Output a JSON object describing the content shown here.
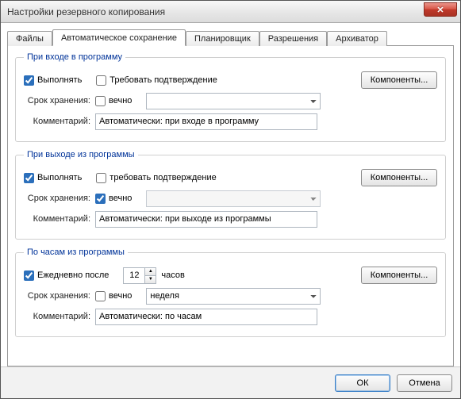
{
  "window": {
    "title": "Настройки резервного копирования"
  },
  "tabs": {
    "files": "Файлы",
    "autosave": "Автоматическое сохранение",
    "scheduler": "Планировщик",
    "permissions": "Разрешения",
    "archiver": "Архиватор"
  },
  "common": {
    "components_btn": "Компоненты...",
    "storage_label": "Срок хранения:",
    "forever": "вечно",
    "comment_label": "Комментарий:"
  },
  "login_group": {
    "legend": "При входе в программу",
    "execute_label": "Выполнять",
    "execute_checked": true,
    "confirm_label": "Требовать подтверждение",
    "confirm_checked": false,
    "forever_checked": false,
    "duration_value": "",
    "comment_value": "Автоматически: при входе в программу"
  },
  "logout_group": {
    "legend": "При выходе из программы",
    "execute_label": "Выполнять",
    "execute_checked": true,
    "confirm_label": "требовать подтверждение",
    "confirm_checked": false,
    "forever_checked": true,
    "duration_value": "",
    "comment_value": "Автоматически: при выходе из программы"
  },
  "clock_group": {
    "legend": "По часам из программы",
    "daily_label": "Ежедневно после",
    "daily_checked": true,
    "hours_value": "12",
    "hours_suffix": "часов",
    "forever_checked": false,
    "duration_value": "неделя",
    "comment_value": "Автоматически: по часам"
  },
  "footer": {
    "ok": "ОК",
    "cancel": "Отмена"
  }
}
